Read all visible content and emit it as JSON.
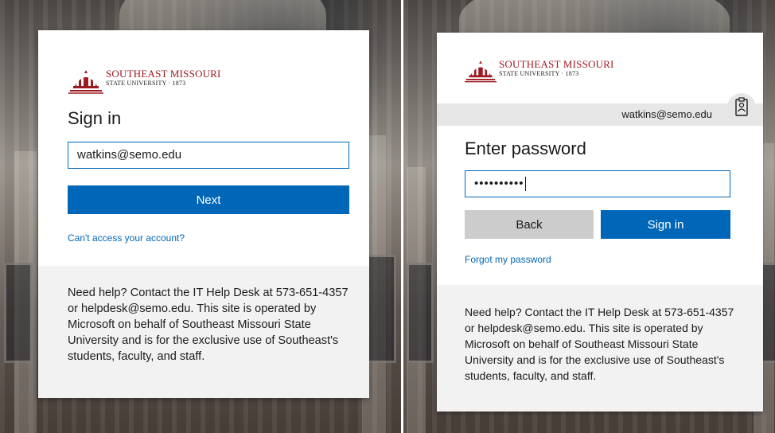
{
  "logo": {
    "line1": "SOUTHEAST MISSOURI",
    "line2": "STATE UNIVERSITY · 1873"
  },
  "signin": {
    "heading": "Sign in",
    "email_value": "watkins@semo.edu",
    "next_label": "Next",
    "cant_access_link": "Can't access your account?"
  },
  "password": {
    "identity_email": "watkins@semo.edu",
    "heading": "Enter password",
    "password_mask": "••••••••••",
    "back_label": "Back",
    "signin_label": "Sign in",
    "forgot_link": "Forgot my password"
  },
  "help": {
    "text": "Need help? Contact the IT Help Desk at 573-651-4357 or helpdesk@semo.edu. This site is operated by Microsoft on behalf of Southeast Missouri State University and is for the exclusive use of Southeast's students, faculty, and staff."
  },
  "colors": {
    "brand_red": "#9c1b22",
    "primary_blue": "#0067b8",
    "help_bg": "#f2f2f2"
  }
}
